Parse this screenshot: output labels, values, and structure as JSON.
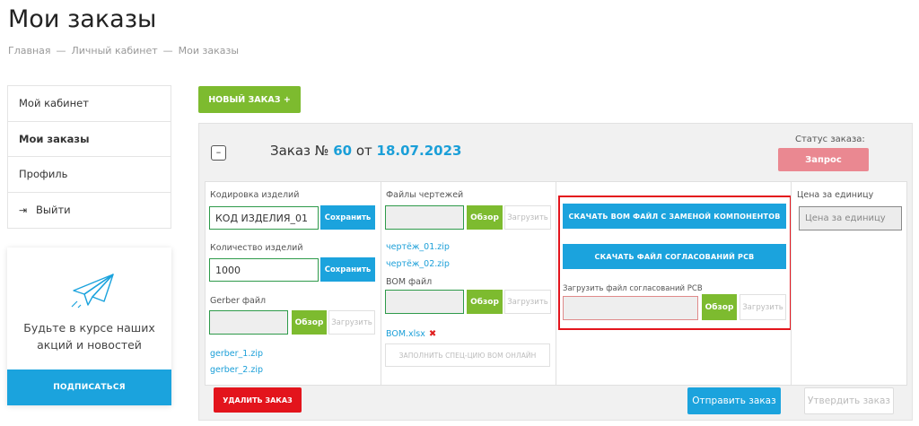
{
  "page_title": "Мои заказы",
  "breadcrumb": {
    "items": [
      "Главная",
      "Личный кабинет",
      "Мои заказы"
    ],
    "separator": "—"
  },
  "sidebar": {
    "items": [
      {
        "label": "Мой кабинет"
      },
      {
        "label": "Мои заказы",
        "active": true
      },
      {
        "label": "Профиль"
      },
      {
        "label": "Выйти",
        "icon": "logout-icon"
      }
    ]
  },
  "promo": {
    "icon": "paper-plane-icon",
    "text_line1": "Будьте в курсе наших",
    "text_line2": "акций и новостей",
    "button_label": "ПОДПИСАТЬСЯ"
  },
  "new_order": {
    "label": "НОВЫЙ ЗАКАЗ",
    "icon": "+"
  },
  "order": {
    "collapse_label": "–",
    "title_prefix": "Заказ №",
    "number": "60",
    "title_from": "от",
    "date": "18.07.2023",
    "status_label": "Статус заказа:",
    "status": "Запрос",
    "col1": {
      "code_label": "Кодировка изделий",
      "code_value": "КОД ИЗДЕЛИЯ_01",
      "save_label": "Сохранить",
      "qty_label": "Количество изделий",
      "qty_value": "1000",
      "save2_label": "Сохранить",
      "gerber_label": "Gerber файл",
      "browse_label": "Обзор",
      "upload_label": "Загрузить",
      "files": [
        "gerber_1.zip",
        "gerber_2.zip"
      ]
    },
    "col2": {
      "drawings_label": "Файлы чертежей",
      "browse_label": "Обзор",
      "upload_label": "Загрузить",
      "drawings": [
        "чертёж_01.zip",
        "чертёж_02.zip"
      ],
      "bom_label": "BOM файл",
      "browse2_label": "Обзор",
      "upload2_label": "Загрузить",
      "bom_file": "BOM.xlsx",
      "remove_icon": "✖",
      "fill_online_label": "ЗАПОЛНИТЬ СПЕЦ-ЦИЮ BOM ОНЛАЙН"
    },
    "col3": {
      "download_bom_label": "СКАЧАТЬ BOM ФАЙЛ С ЗАМЕНОЙ КОМПОНЕНТОВ",
      "download_pcb_label": "СКАЧАТЬ ФАЙЛ СОГЛАСОВАНИЙ PCB",
      "upload_pcb_label": "Загрузить файл согласований PCB",
      "browse_label": "Обзор",
      "upload_label": "Загрузить"
    },
    "col4": {
      "price_label": "Цена за единицу",
      "price_placeholder": "Цена за единицу"
    },
    "delete_label": "УДАЛИТЬ ЗАКАЗ",
    "send_label": "Отправить заказ",
    "confirm_label": "Утвердить заказ"
  },
  "colors": {
    "accent_blue": "#1ba3dd",
    "accent_green": "#7dbb2f",
    "status_pink": "#ea8891",
    "danger_red": "#e3141c"
  }
}
